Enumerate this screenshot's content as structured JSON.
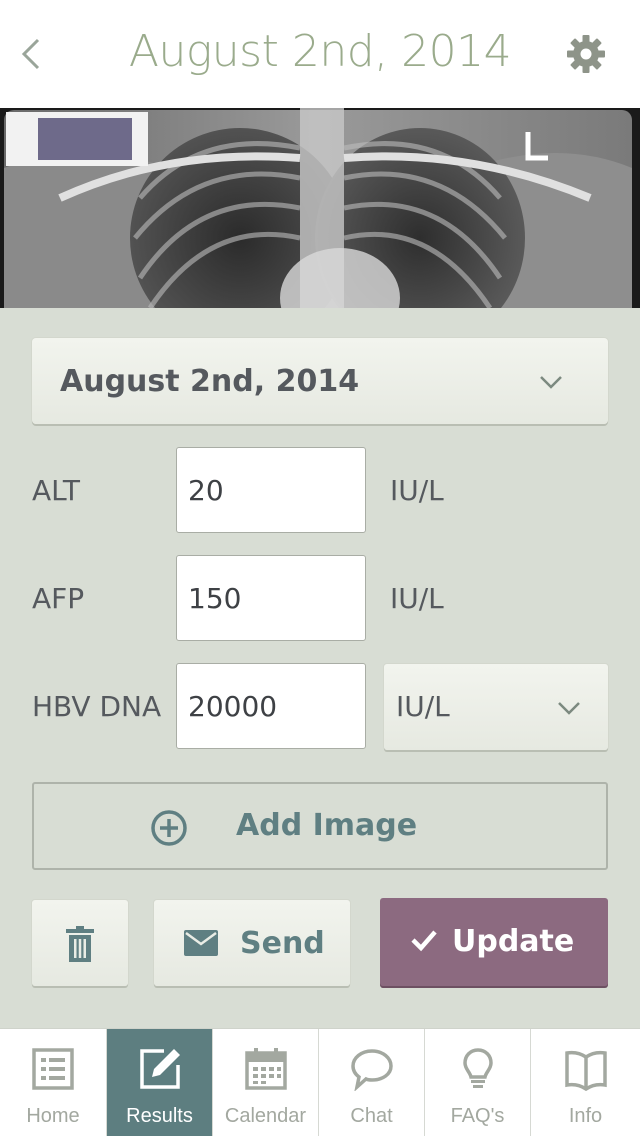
{
  "header": {
    "title": "August 2nd, 2014",
    "back_icon": "chevron-left-icon",
    "settings_icon": "gear-icon"
  },
  "date_select": {
    "value": "August 2nd, 2014"
  },
  "fields": [
    {
      "label": "ALT",
      "value": "20",
      "unit": "IU/L"
    },
    {
      "label": "AFP",
      "value": "150",
      "unit": "IU/L"
    },
    {
      "label": "HBV DNA",
      "value": "20000",
      "unit": "IU/L"
    }
  ],
  "add_image": {
    "label": "Add Image"
  },
  "actions": {
    "send_label": "Send",
    "update_label": "Update"
  },
  "tabs": [
    {
      "label": "Home",
      "icon": "list-icon"
    },
    {
      "label": "Results",
      "icon": "edit-icon",
      "active": true
    },
    {
      "label": "Calendar",
      "icon": "calendar-icon"
    },
    {
      "label": "Chat",
      "icon": "chat-bubble-icon"
    },
    {
      "label": "FAQ's",
      "icon": "lightbulb-icon"
    },
    {
      "label": "Info",
      "icon": "book-icon"
    }
  ],
  "colors": {
    "accent_title": "#9aab8c",
    "teal": "#5f7f82",
    "update_button": "#8c6a80",
    "background": "#d8ddd4"
  }
}
